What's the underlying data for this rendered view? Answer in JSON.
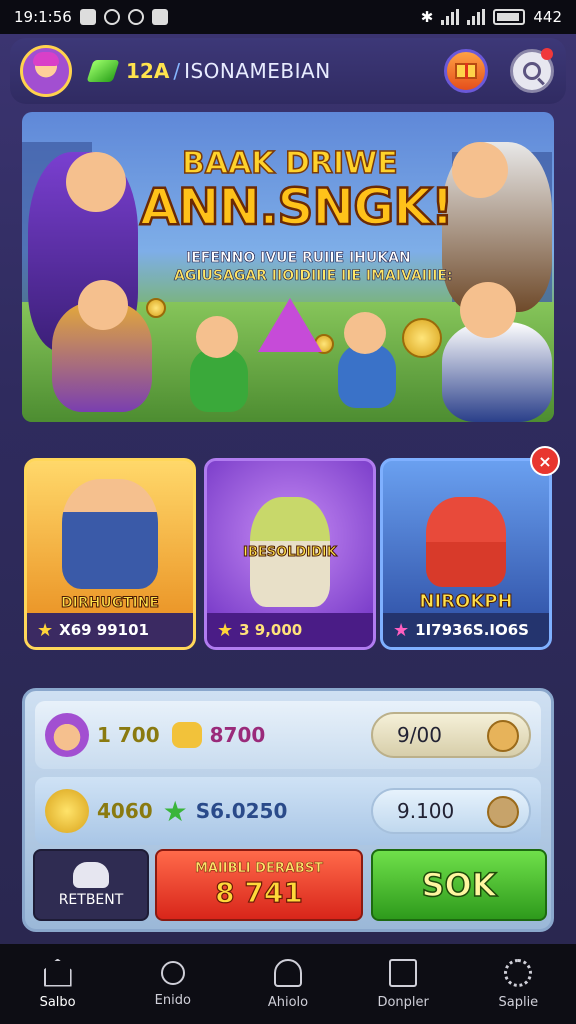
{
  "status_bar": {
    "time": "19:1:56",
    "battery": "442"
  },
  "header": {
    "level": "12A",
    "separator": "/",
    "player_name": "ISONAMEBIAN"
  },
  "banner": {
    "title_line1": "BAAK DRIWE",
    "title_line2": "ANN.SNGK!",
    "subtitle_line1": "IEFENNO IVUE RUIIE IHUKAN",
    "subtitle_line2": "AGIUSAGAR IIOIDIIIE IIE IMAIVAIIIE:"
  },
  "cards": [
    {
      "title": "DIRHUGTINE",
      "value": "X69 99101"
    },
    {
      "title": "IBESOLDIDIK",
      "value": "3 9,000"
    },
    {
      "title": "NIROKPH",
      "value": "1I7936S.IO6S"
    }
  ],
  "panel": {
    "row1": {
      "value1": "1 700",
      "value2": "8700",
      "pill": "9/00"
    },
    "row2": {
      "value1": "4060",
      "value2": "S6.0250",
      "pill": "9.100"
    }
  },
  "actions": {
    "report_label": "RETBENT",
    "main_line1": "MAIIBLI DERABST",
    "main_line2": "8 741",
    "ok_label": "SOK"
  },
  "nav": [
    {
      "label": "Salbo",
      "icon": "home-icon"
    },
    {
      "label": "Enido",
      "icon": "search-icon"
    },
    {
      "label": "Ahiolo",
      "icon": "bell-icon"
    },
    {
      "label": "Donpler",
      "icon": "document-icon"
    },
    {
      "label": "Saplie",
      "icon": "gear-icon"
    }
  ],
  "colors": {
    "app_bg": "#2f2b5e",
    "accent_gold": "#ffc21a",
    "ok_green": "#2e9a1c",
    "main_red": "#d8261a"
  }
}
